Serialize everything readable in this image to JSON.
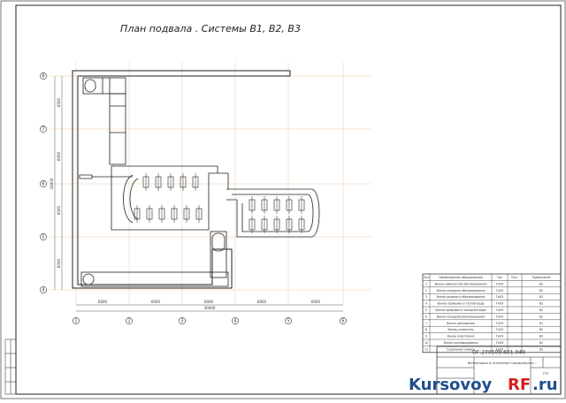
{
  "drawing": {
    "title": "План подвала . Системы В1, В2, В3",
    "row_axes": [
      "8",
      "7",
      "6",
      "5",
      "4"
    ],
    "col_axes": [
      "1",
      "2",
      "3",
      "4",
      "5",
      "6"
    ],
    "row_dims": [
      "6000",
      "6000",
      "6000",
      "6000"
    ],
    "row_total": "24000",
    "col_dims": [
      "6000",
      "6000",
      "6000",
      "6000",
      "6000"
    ],
    "col_total": "30000"
  },
  "spec_table": {
    "headers": [
      "Поз",
      "Наименование оборудования",
      "Тип",
      "Кол.",
      "Примечание"
    ],
    "rows": [
      {
        "pos": "1",
        "name": "Ванна химической обезжиривания",
        "type": "ТиОЗ",
        "qty": "",
        "note": "В2"
      },
      {
        "pos": "2",
        "name": "Ванна холодная обезжиривания",
        "type": "ТиОЗ",
        "qty": "",
        "note": "В2"
      },
      {
        "pos": "3",
        "name": "Ванна анодного обезжиривания",
        "type": "ТиОЗ",
        "qty": "",
        "note": "В2"
      },
      {
        "pos": "4",
        "name": "Ванна промывки в теплой воде",
        "type": "ТиОЗ",
        "qty": "",
        "note": "В2"
      },
      {
        "pos": "5",
        "name": "Ванна промывки в холодной воде",
        "type": "ТиОЗ",
        "qty": "",
        "note": "В2"
      },
      {
        "pos": "6",
        "name": "Ванна холодной декапирования",
        "type": "ТиОЗ",
        "qty": "",
        "note": "В2"
      },
      {
        "pos": "7",
        "name": "Ванна цинкования",
        "type": "ТиОЗ",
        "qty": "",
        "note": "В1"
      },
      {
        "pos": "8",
        "name": "Ванна-уловитель",
        "type": "ТиОЗ",
        "qty": "",
        "note": "В2"
      },
      {
        "pos": "9",
        "name": "Ванна осветления",
        "type": "ТиОЗ",
        "qty": "",
        "note": "В2"
      },
      {
        "pos": "10",
        "name": "Ванна пассивирования",
        "type": "ТиОЗ",
        "qty": "",
        "note": "В2"
      },
      {
        "pos": "11",
        "name": "Сушильная камера",
        "type": "ТиОЗ",
        "qty": "",
        "note": "В3"
      }
    ]
  },
  "title_block": {
    "code": "ОГ.270109.601.040",
    "name": "Вентиляция и отопление гальваническ...",
    "sheet": "ТГ5"
  },
  "watermark": {
    "part1": "Kursovoy",
    "part2": "RF",
    "part3": ".ru"
  },
  "colors": {
    "line": "#222222",
    "grid": "#f2c9a4",
    "watermark_blue": "#1f4f8f",
    "watermark_red": "#d42020"
  }
}
